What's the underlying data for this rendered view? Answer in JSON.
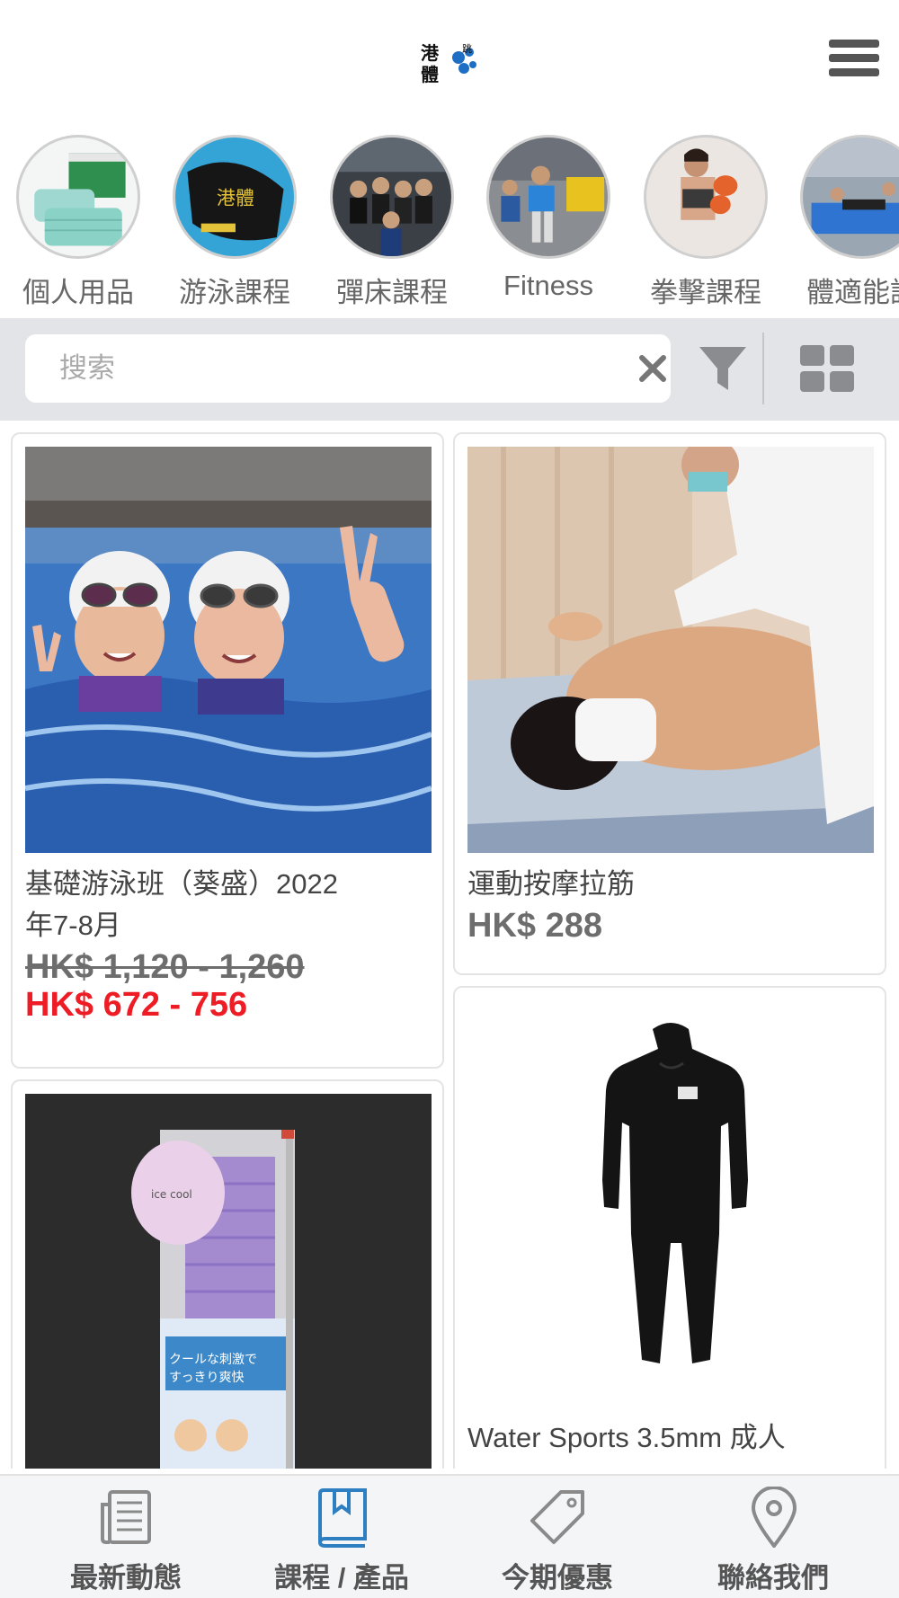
{
  "header": {
    "logo_icon": "brand-logo",
    "menu_icon": "hamburger-menu-icon"
  },
  "categories": [
    {
      "label": "個人用品",
      "icon": "face-mask-photo"
    },
    {
      "label": "游泳課程",
      "icon": "swim-cap-photo"
    },
    {
      "label": "彈床課程",
      "icon": "trampoline-group-photo"
    },
    {
      "label": "Fitness",
      "icon": "fitness-photo"
    },
    {
      "label": "拳擊課程",
      "icon": "boxing-photo"
    },
    {
      "label": "體適能訓",
      "icon": "stretching-photo"
    }
  ],
  "search": {
    "placeholder": "搜索",
    "value": ""
  },
  "products": [
    {
      "title": "基礎游泳班（葵盛）2022年7-8月",
      "title_line1": "基礎游泳班（葵盛）2022",
      "title_line2": "年7-8月",
      "price_original": "HK$ 1,120 - 1,260",
      "price_sale": "HK$ 672 - 756",
      "image": "swimming-kids-photo"
    },
    {
      "title": "運動按摩拉筋",
      "price": "HK$ 288",
      "image": "sports-massage-photo"
    },
    {
      "title": "",
      "image": "cooling-towel-photo"
    },
    {
      "title": "Water Sports 3.5mm 成人",
      "image": "wetsuit-photo"
    }
  ],
  "bottom_nav": [
    {
      "label": "最新動態",
      "icon": "news-icon",
      "active": false
    },
    {
      "label": "課程 / 產品",
      "icon": "book-icon",
      "active": true
    },
    {
      "label": "今期優惠",
      "icon": "tag-icon",
      "active": false
    },
    {
      "label": "聯絡我們",
      "icon": "location-pin-icon",
      "active": false
    }
  ],
  "colors": {
    "sale_price": "#ee1c24",
    "active_nav": "#2d7fc1",
    "inactive_nav": "#8a8a8a",
    "search_bg": "#e2e4e8"
  }
}
